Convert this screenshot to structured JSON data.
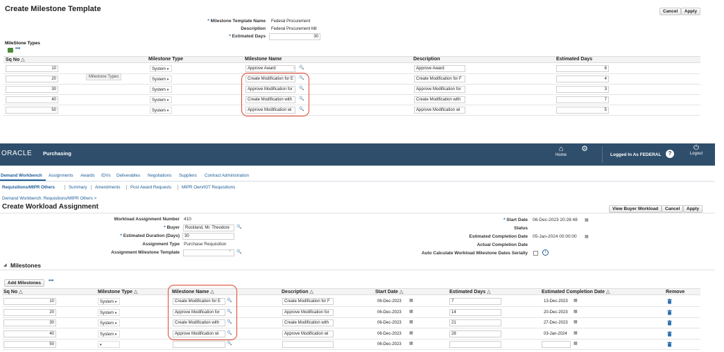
{
  "template_page": {
    "title": "Create Milestone Template",
    "cancel": "Cancel",
    "apply": "Apply",
    "fields": {
      "name_label": "Milestone Template Name",
      "name_value": "Federal Procurement",
      "desc_label": "Description",
      "desc_value": "Federal Procurement Mil",
      "days_label": "Estimated Days",
      "days_value": "30"
    },
    "section_title": "MileStone Types",
    "more": "•••",
    "tooltip": "Milestone Types",
    "columns": {
      "sq": "Sq No",
      "type": "Milestone Type",
      "name": "Milestone Name",
      "desc": "Description",
      "days": "Estimated Days"
    },
    "rows": [
      {
        "sq": "10",
        "type": "System",
        "name": "Approve Award",
        "desc": "Approve Award",
        "days": "6"
      },
      {
        "sq": "20",
        "type": "System",
        "name": "Create Modification for E",
        "desc": "Create Modification for F",
        "days": "4"
      },
      {
        "sq": "30",
        "type": "System",
        "name": "Approve Modification for",
        "desc": "Approve Modification for",
        "days": "3"
      },
      {
        "sq": "40",
        "type": "System",
        "name": "Create Modification with",
        "desc": "Create Modification with",
        "days": "7"
      },
      {
        "sq": "50",
        "type": "System",
        "name": "Approve Modification wi",
        "desc": "Approve Modification wi",
        "days": "5"
      }
    ]
  },
  "banner": {
    "logo": "ORACLE",
    "app": "Purchasing",
    "home": "Home",
    "logged_in": "Logged In As FEDERAL",
    "logout": "Logout",
    "help": "?"
  },
  "tabs": [
    "Demand Workbench",
    "Assignments",
    "Awards",
    "IDVs",
    "Deliverables",
    "Negotiations",
    "Suppliers",
    "Contract Administration"
  ],
  "subtabs": [
    "Requisitions/MIPR Others",
    "Summary",
    "Amendments",
    "Post Award Requests",
    "MIPR Own/IGT Requisitions"
  ],
  "breadcrumb": "Demand Workbench: Requisitions/MIPR Others  >",
  "workload_page": {
    "title": "Create Workload Assignment",
    "view_buyer": "View Buyer Workload",
    "cancel": "Cancel",
    "apply": "Apply",
    "left": {
      "number_label": "Workload Assignment Number",
      "number_value": "410",
      "buyer_label": "Buyer",
      "buyer_value": "Rockland, Mr. Theodore",
      "duration_label": "Estimated Duration (Days)",
      "duration_value": "30",
      "type_label": "Assignment Type",
      "type_value": "Purchase Requisition",
      "template_label": "Assignment Milestone Template",
      "template_value": ""
    },
    "right": {
      "start_label": "Start Date",
      "start_value": "06-Dec-2023 20:28:48",
      "status_label": "Status",
      "status_value": "",
      "est_completion_label": "Estimated Completion Date",
      "est_completion_value": "05-Jan-2024 00:00:00",
      "actual_label": "Actual Completion Date",
      "actual_value": "",
      "auto_calc_label": "Auto Calculate Workload Milestone Dates Serially"
    },
    "milestones_title": "Milestones",
    "add_milestones": "Add Milestones",
    "more": "•••",
    "columns": {
      "sq": "Sq No",
      "type": "Milestone Type",
      "name": "Milestone Name",
      "desc": "Description",
      "start": "Start Date",
      "days": "Estimated Days",
      "completion": "Estimated Completion Date",
      "remove": "Remove"
    },
    "rows": [
      {
        "sq": "10",
        "type": "System",
        "name": "Create Modification for E",
        "desc": "Create Modification for F",
        "start": "06-Dec-2023",
        "days": "7",
        "completion": "13-Dec-2023"
      },
      {
        "sq": "20",
        "type": "System",
        "name": "Approve Modification for",
        "desc": "Approve Modification for",
        "start": "06-Dec-2023",
        "days": "14",
        "completion": "20-Dec-2023"
      },
      {
        "sq": "30",
        "type": "System",
        "name": "Create Modification with",
        "desc": "Create Modification with",
        "start": "06-Dec-2023",
        "days": "21",
        "completion": "27-Dec-2023"
      },
      {
        "sq": "40",
        "type": "System",
        "name": "Approve Modification wi",
        "desc": "Approve Modification wi",
        "start": "06-Dec-2023",
        "days": "28",
        "completion": "03-Jan-2024"
      },
      {
        "sq": "50",
        "type": "",
        "name": "",
        "desc": "",
        "start": "06-Dec-2023",
        "days": "",
        "completion": ""
      }
    ]
  }
}
